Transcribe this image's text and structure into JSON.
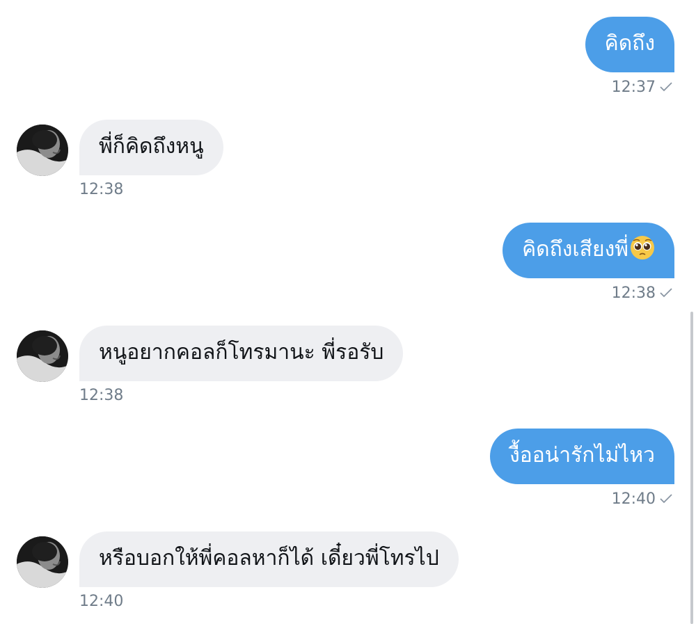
{
  "messages": [
    {
      "direction": "outgoing",
      "text": "คิดถึง",
      "time": "12:37",
      "status": "sent-check-icon"
    },
    {
      "direction": "incoming",
      "text": "พี่ก็คิดถึงหนู",
      "time": "12:38"
    },
    {
      "direction": "outgoing",
      "text": "คิดถึงเสียงพี่",
      "emoji": "pleading-face-emoji",
      "time": "12:38",
      "status": "sent-check-icon"
    },
    {
      "direction": "incoming",
      "text": "หนูอยากคอลก็โทรมานะ พี่รอรับ",
      "time": "12:38"
    },
    {
      "direction": "outgoing",
      "text": "งื้ออน่ารักไม่ไหว",
      "time": "12:40",
      "status": "sent-check-icon"
    },
    {
      "direction": "incoming",
      "text": "หรือบอกให้พี่คอลหาก็ได้ เดี๋ยวพี่โทรไป",
      "time": "12:40"
    }
  ],
  "colors": {
    "outgoing_bubble": "#4c9ee8",
    "incoming_bubble": "#eeeff2",
    "timestamp": "#6f7c89"
  }
}
